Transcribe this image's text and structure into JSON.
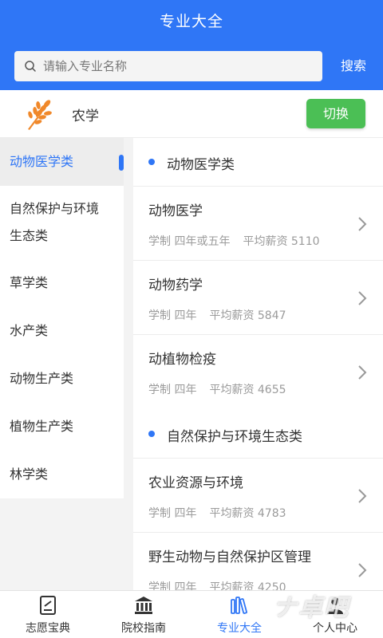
{
  "header": {
    "title": "专业大全"
  },
  "search": {
    "placeholder": "请输入专业名称",
    "button": "搜索"
  },
  "category": {
    "name": "农学",
    "switch_label": "切换",
    "icon": "wheat-icon"
  },
  "sidebar": {
    "items": [
      {
        "label": "动物医学类",
        "active": true
      },
      {
        "label": "自然保护与环境",
        "label2": "生态类"
      },
      {
        "label": "草学类"
      },
      {
        "label": "水产类"
      },
      {
        "label": "动物生产类"
      },
      {
        "label": "植物生产类"
      },
      {
        "label": "林学类"
      }
    ]
  },
  "sections": [
    {
      "title": "动物医学类",
      "majors": [
        {
          "name": "动物医学",
          "duration": "学制 四年或五年",
          "salary": "平均薪资 5110"
        },
        {
          "name": "动物药学",
          "duration": "学制 四年",
          "salary": "平均薪资 5847"
        },
        {
          "name": "动植物检疫",
          "duration": "学制 四年",
          "salary": "平均薪资 4655"
        }
      ]
    },
    {
      "title": "自然保护与环境生态类",
      "majors": [
        {
          "name": "农业资源与环境",
          "duration": "学制 四年",
          "salary": "平均薪资 4783"
        },
        {
          "name": "野生动物与自然保护区管理",
          "duration": "学制 四年",
          "salary": "平均薪资 4250"
        }
      ]
    }
  ],
  "tabbar": {
    "tabs": [
      {
        "label": "志愿宝典",
        "icon": "notebook-icon"
      },
      {
        "label": "院校指南",
        "icon": "institution-icon"
      },
      {
        "label": "专业大全",
        "icon": "books-icon",
        "active": true
      },
      {
        "label": "个人中心",
        "icon": "person-icon"
      }
    ]
  },
  "watermark": "ナ卓吧",
  "colors": {
    "primary": "#2f76f6",
    "switch": "#4bbf55",
    "wheat": "#f0882a"
  }
}
